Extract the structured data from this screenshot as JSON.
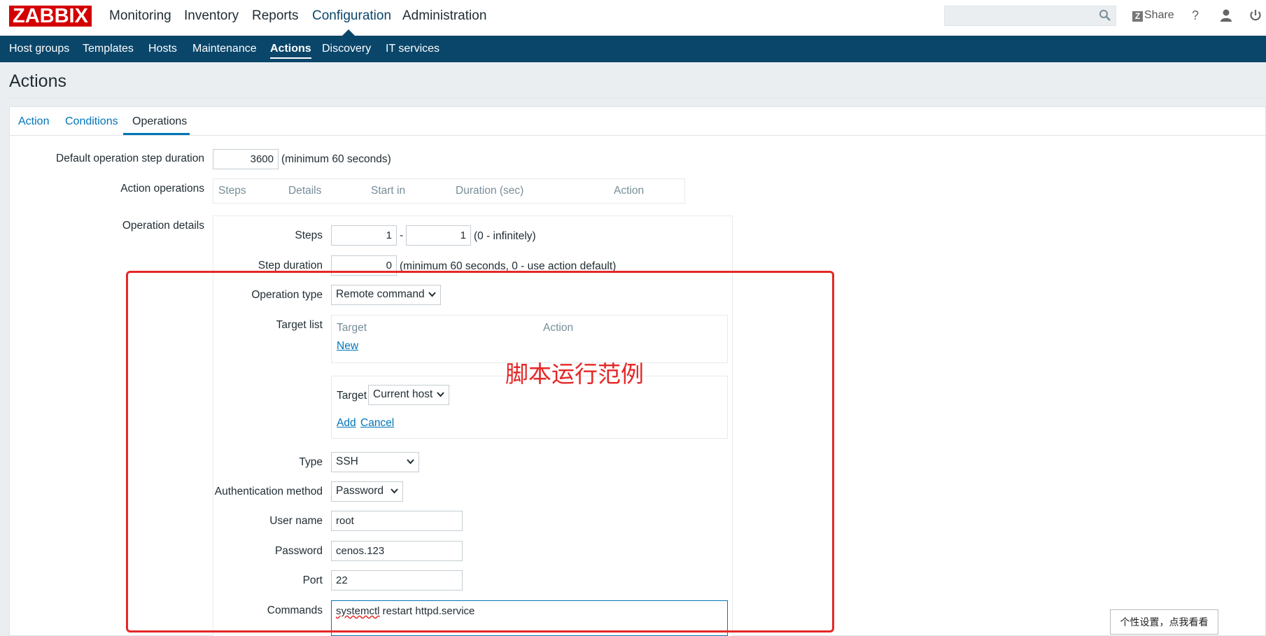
{
  "brand": {
    "logo_text": "ZABBIX"
  },
  "main_menu": [
    "Monitoring",
    "Inventory",
    "Reports",
    "Configuration",
    "Administration"
  ],
  "main_menu_active": "Configuration",
  "header": {
    "share_label": "Share",
    "help_label": "?"
  },
  "sub_menu": [
    "Host groups",
    "Templates",
    "Hosts",
    "Maintenance",
    "Actions",
    "Discovery",
    "IT services"
  ],
  "sub_menu_active": "Actions",
  "page": {
    "title": "Actions"
  },
  "tabs": [
    "Action",
    "Conditions",
    "Operations"
  ],
  "tabs_active": "Operations",
  "form": {
    "default_step_label": "Default operation step duration",
    "default_step_value": "3600",
    "default_step_hint": "(minimum 60 seconds)",
    "action_ops_label": "Action operations",
    "action_ops_columns": [
      "Steps",
      "Details",
      "Start in",
      "Duration (sec)",
      "Action"
    ],
    "op_details_label": "Operation details",
    "steps_label": "Steps",
    "steps_from": "1",
    "steps_sep": "-",
    "steps_to": "1",
    "steps_hint": "(0 - infinitely)",
    "step_duration_label": "Step duration",
    "step_duration_value": "0",
    "step_duration_hint": "(minimum 60 seconds, 0 - use action default)",
    "op_type_label": "Operation type",
    "op_type_value": "Remote command",
    "target_list_label": "Target list",
    "target_list_columns": [
      "Target",
      "Action"
    ],
    "target_list_new": "New",
    "target_label": "Target",
    "target_value": "Current host",
    "target_add": "Add",
    "target_cancel": "Cancel",
    "type_label": "Type",
    "type_value": "SSH",
    "auth_label": "Authentication method",
    "auth_value": "Password",
    "username_label": "User name",
    "username_value": "root",
    "password_label": "Password",
    "password_value": "cenos.123",
    "port_label": "Port",
    "port_value": "22",
    "commands_label": "Commands",
    "commands_word1": "systemctl",
    "commands_rest": " restart httpd.service"
  },
  "annotation": {
    "text": "脚本运行范例",
    "color": "#e52727"
  },
  "tooltip": {
    "text": "个性设置，点我看看"
  },
  "colors": {
    "nav_bg": "#0a466a",
    "logo_bg": "#d40000",
    "link": "#0275b8",
    "page_bg": "#ebeef0"
  }
}
